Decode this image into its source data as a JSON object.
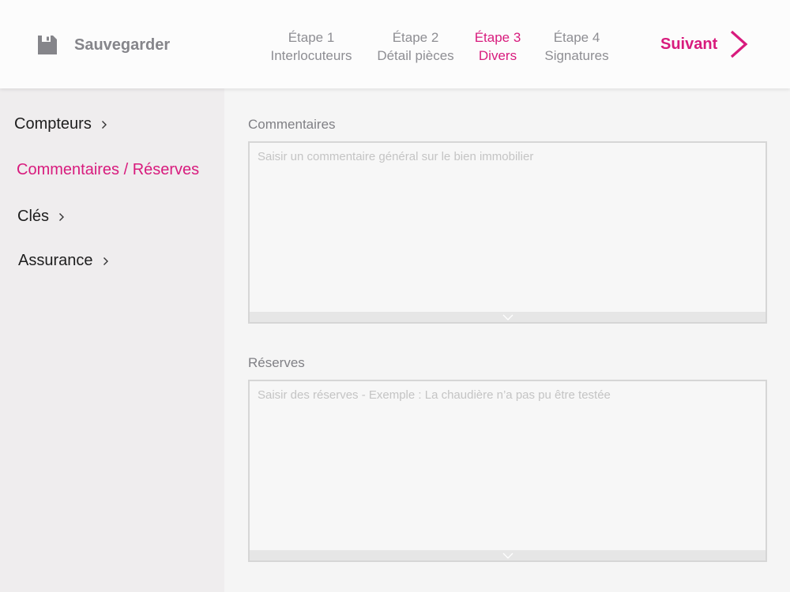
{
  "header": {
    "save_label": "Sauvegarder",
    "next_label": "Suivant",
    "steps": [
      {
        "line1": "Étape 1",
        "line2": "Interlocuteurs"
      },
      {
        "line1": "Étape 2",
        "line2": "Détail pièces"
      },
      {
        "line1": "Étape 3",
        "line2": "Divers"
      },
      {
        "line1": "Étape 4",
        "line2": "Signatures"
      }
    ],
    "active_step": 3
  },
  "sidebar": {
    "items": [
      {
        "label": "Compteurs",
        "icon": "chevron-right-icon"
      },
      {
        "label": "Commentaires / Réserves"
      },
      {
        "label": "Clés",
        "icon": "chevron-right-icon"
      },
      {
        "label": "Assurance",
        "icon": "chevron-right-icon"
      }
    ],
    "active_item": 1
  },
  "main": {
    "comments": {
      "label": "Commentaires",
      "placeholder": "Saisir un commentaire général sur le bien immobilier",
      "value": ""
    },
    "reserves": {
      "label": "Réserves",
      "placeholder": "Saisir des réserves - Exemple : La chaudière n’a pas pu être testée",
      "value": ""
    }
  },
  "colors": {
    "accent": "#d81b7d",
    "muted_text": "#8e8e93",
    "sidebar_bg": "#efedee",
    "header_bg": "#fcfcfc"
  }
}
